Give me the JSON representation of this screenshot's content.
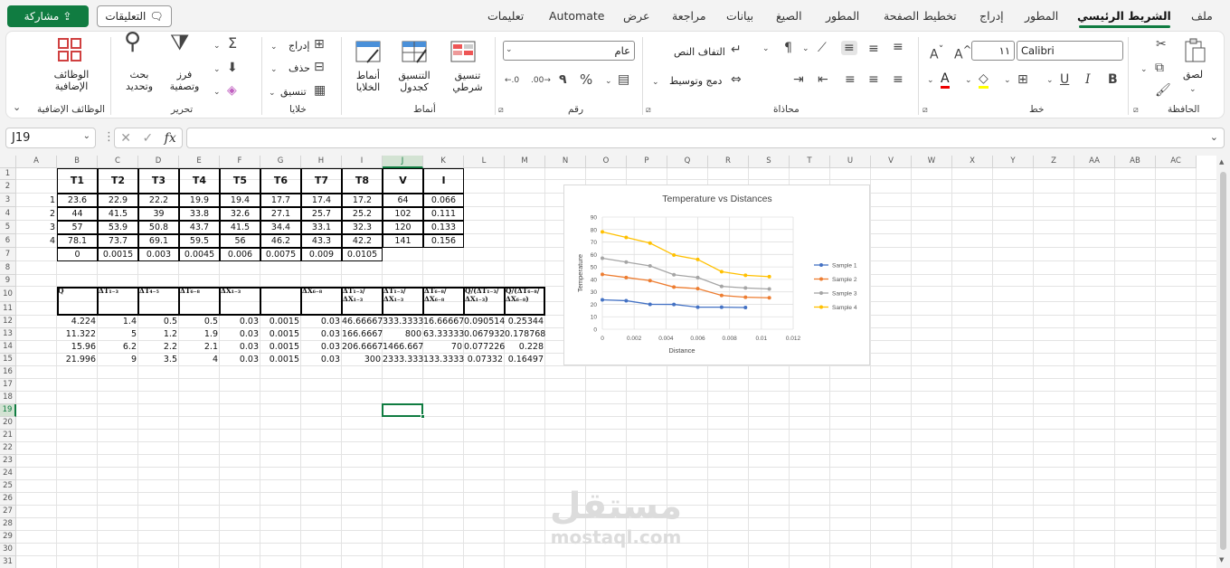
{
  "menu": {
    "tabs": [
      "ملف",
      "الشريط الرئيسي",
      "المطور",
      "إدراج",
      "تخطيط الصفحة",
      "المطور",
      "الصيغ",
      "بيانات",
      "مراجعة",
      "عرض",
      "Automate",
      "تعليمات"
    ],
    "active_tab": "الشريط الرئيسي",
    "share_label": "مشاركة",
    "comments_label": "التعليقات"
  },
  "ribbon": {
    "clipboard": {
      "label": "الحافظة",
      "paste": "لصق"
    },
    "font": {
      "label": "خط",
      "name": "Calibri",
      "size": "١١",
      "bold": "B",
      "italic": "I",
      "underline": "U"
    },
    "alignment": {
      "label": "محاذاة",
      "wrap_text": "التفاف النص",
      "merge_center": "دمج وتوسيط"
    },
    "number": {
      "label": "رقم",
      "format": "عام",
      "percent": "%",
      "comma": "٩"
    },
    "styles": {
      "label": "أنماط",
      "conditional": "تنسيق شرطي",
      "format_table": "التنسيق كجدول",
      "cell_styles": "أنماط الخلايا"
    },
    "cells": {
      "label": "خلايا",
      "insert": "إدراج",
      "delete": "حذف",
      "format": "تنسيق"
    },
    "editing": {
      "label": "تحرير",
      "sort_filter": "فرز وتصفية",
      "find_select": "بحث وتحديد",
      "sum": "Σ"
    },
    "addins": {
      "label": "الوظائف الإضافية",
      "button": "الوظائف الإضافية"
    }
  },
  "formula_bar": {
    "name_box": "J19",
    "fx": "fx",
    "formula": ""
  },
  "grid": {
    "columns": [
      "A",
      "B",
      "C",
      "D",
      "E",
      "F",
      "G",
      "H",
      "I",
      "J",
      "K",
      "L",
      "M",
      "N",
      "O",
      "P",
      "Q",
      "R",
      "S",
      "T",
      "U",
      "V",
      "W",
      "X",
      "Y",
      "Z",
      "AA",
      "AB",
      "AC"
    ],
    "rows": [
      "1",
      "2",
      "3",
      "4",
      "5",
      "6",
      "7",
      "8",
      "9",
      "10",
      "11",
      "12",
      "13",
      "14",
      "15",
      "16",
      "17",
      "18",
      "19",
      "20",
      "21",
      "22",
      "23",
      "24",
      "25",
      "26",
      "27",
      "28",
      "29",
      "30",
      "31"
    ],
    "selected_cell": "J19"
  },
  "table1": {
    "headers": [
      "T1",
      "T2",
      "T3",
      "T4",
      "T5",
      "T6",
      "T7",
      "T8",
      "V",
      "I"
    ],
    "row_labels": [
      "1",
      "2",
      "3",
      "4"
    ],
    "rows": [
      [
        "23.6",
        "22.9",
        "22.2",
        "19.9",
        "19.4",
        "17.7",
        "17.4",
        "17.2",
        "64",
        "0.066"
      ],
      [
        "44",
        "41.5",
        "39",
        "33.8",
        "32.6",
        "27.1",
        "25.7",
        "25.2",
        "102",
        "0.111"
      ],
      [
        "57",
        "53.9",
        "50.8",
        "43.7",
        "41.5",
        "34.4",
        "33.1",
        "32.3",
        "120",
        "0.133"
      ],
      [
        "78.1",
        "73.7",
        "69.1",
        "59.5",
        "56",
        "46.2",
        "43.3",
        "42.2",
        "141",
        "0.156"
      ]
    ],
    "distances": [
      "0",
      "0.0015",
      "0.003",
      "0.0045",
      "0.006",
      "0.0075",
      "0.009",
      "0.0105"
    ]
  },
  "table2": {
    "headers": [
      "Q",
      "ΔT₁₋₃",
      "ΔT₄₋₅",
      "ΔT₆₋₈",
      "ΔX₁₋₃",
      "",
      "ΔX₆₋₈",
      "ΔT₁₋₃/ΔX₁₋₃",
      "ΔT₁₋₃/ΔX₁₋₃",
      "ΔT₆₋₈/ΔX₆₋₈",
      "Q/(ΔT₁₋₃/ΔX₁₋₃)",
      "Q/(ΔT₆₋₈/ΔX₆₋₈)"
    ],
    "rows": [
      [
        "4.224",
        "1.4",
        "0.5",
        "0.5",
        "0.03",
        "0.0015",
        "0.03",
        "46.66667",
        "333.3333",
        "16.66667",
        "0.090514",
        "0.25344"
      ],
      [
        "11.322",
        "5",
        "1.2",
        "1.9",
        "0.03",
        "0.0015",
        "0.03",
        "166.6667",
        "800",
        "63.33333",
        "0.067932",
        "0.178768"
      ],
      [
        "15.96",
        "6.2",
        "2.2",
        "2.1",
        "0.03",
        "0.0015",
        "0.03",
        "206.6667",
        "1466.667",
        "70",
        "0.077226",
        "0.228"
      ],
      [
        "21.996",
        "9",
        "3.5",
        "4",
        "0.03",
        "0.0015",
        "0.03",
        "300",
        "2333.333",
        "133.3333",
        "0.07332",
        "0.16497"
      ]
    ]
  },
  "chart_data": {
    "type": "line",
    "title": "Temperature vs Distances",
    "xlabel": "Distance",
    "ylabel": "Temperature",
    "xlim": [
      0,
      0.012
    ],
    "ylim": [
      0,
      90
    ],
    "xticks": [
      "0",
      "0.002",
      "0.004",
      "0.006",
      "0.008",
      "0.01",
      "0.012"
    ],
    "yticks": [
      "0",
      "10",
      "20",
      "30",
      "40",
      "50",
      "60",
      "70",
      "80",
      "90"
    ],
    "grid": true,
    "legend": "right",
    "x": [
      0,
      0.0015,
      0.003,
      0.0045,
      0.006,
      0.0075,
      0.009,
      0.0105
    ],
    "series": [
      {
        "name": "Sample 1",
        "color": "#4472c4",
        "values": [
          23.6,
          22.9,
          20,
          19.9,
          17.7,
          17.7,
          17.4,
          null
        ]
      },
      {
        "name": "Sample 2",
        "color": "#ed7d31",
        "values": [
          44,
          41.5,
          39,
          33.8,
          32.6,
          27.1,
          25.7,
          25.2
        ]
      },
      {
        "name": "Sample 3",
        "color": "#a5a5a5",
        "values": [
          57,
          53.9,
          50.8,
          43.7,
          41.5,
          34.4,
          33.1,
          32.3
        ]
      },
      {
        "name": "Sample 4",
        "color": "#ffc000",
        "values": [
          78.1,
          73.7,
          69.1,
          59.5,
          56,
          46.2,
          43.3,
          42.2
        ]
      }
    ]
  },
  "watermark": {
    "arabic": "مستقل",
    "english": "mostaql.com"
  },
  "colors": {
    "accent": "#107c41"
  }
}
